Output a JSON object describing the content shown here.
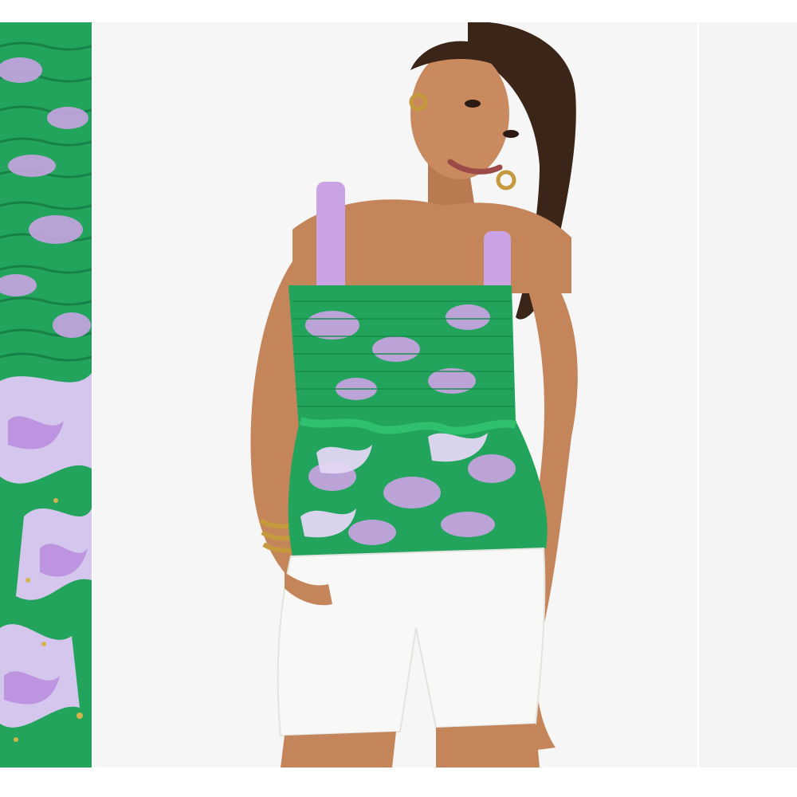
{
  "product_gallery": {
    "images": [
      {
        "role": "detail",
        "alt": "fabric-detail-closeup"
      },
      {
        "role": "main",
        "alt": "model-wearing-top"
      },
      {
        "role": "next",
        "alt": "next-gallery-image"
      }
    ],
    "zoom_icon": "search-icon",
    "colors": {
      "print_green": "#22a45d",
      "print_lilac": "#c9a3e3",
      "print_pale": "#d9d2ec",
      "shorts_white": "#f8f8f6",
      "background": "#f6f6f6"
    }
  }
}
